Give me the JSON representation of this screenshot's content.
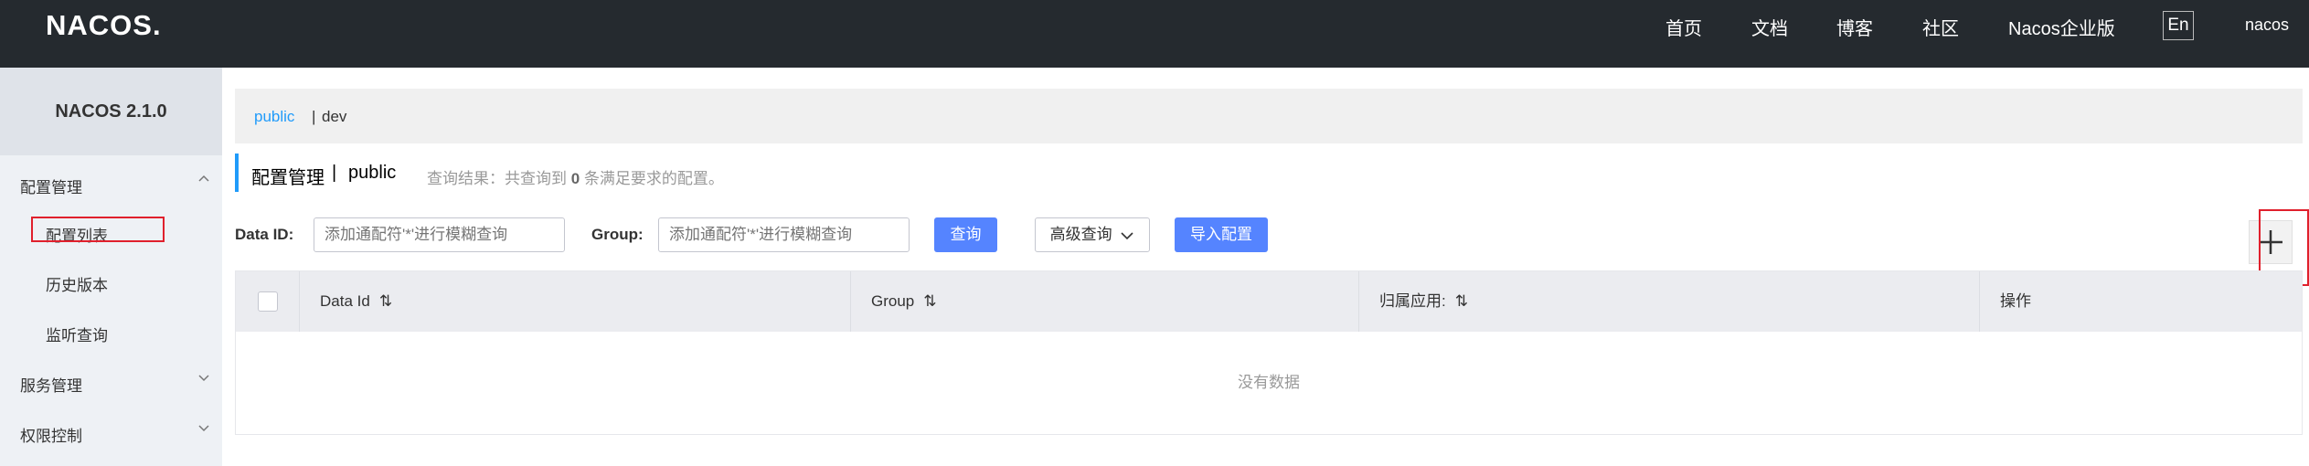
{
  "topbar": {
    "logo": "NACOS.",
    "nav": [
      "首页",
      "文档",
      "博客",
      "社区",
      "Nacos企业版"
    ],
    "lang": "En",
    "user": "nacos"
  },
  "sidebar": {
    "brand": "NACOS 2.1.0",
    "groups": [
      {
        "label": "配置管理",
        "chevron": "chevron-up-icon",
        "items": [
          "配置列表",
          "历史版本",
          "监听查询"
        ]
      },
      {
        "label": "服务管理",
        "chevron": "chevron-down-icon"
      },
      {
        "label": "权限控制",
        "chevron": "chevron-down-icon"
      }
    ]
  },
  "namespace": {
    "public": "public",
    "sep": "|",
    "dev": "dev"
  },
  "header": {
    "title": "配置管理",
    "sep": "|",
    "ns": "public",
    "result_prefix": "查询结果：共查询到",
    "result_count": "0",
    "result_suffix": "条满足要求的配置。"
  },
  "search": {
    "dataid_label": "Data ID:",
    "dataid_placeholder": "添加通配符'*'进行模糊查询",
    "group_label": "Group:",
    "group_placeholder": "添加通配符'*'进行模糊查询",
    "query_btn": "查询",
    "advanced_btn": "高级查询",
    "import_btn": "导入配置",
    "add_btn": "+"
  },
  "table": {
    "columns": [
      "Data Id",
      "Group",
      "归属应用:",
      "操作"
    ],
    "empty": "没有数据"
  },
  "colors": {
    "topbar": "#252a2f",
    "accent": "#209bfa",
    "primary": "#5584ff",
    "highlight": "#e0202c"
  }
}
